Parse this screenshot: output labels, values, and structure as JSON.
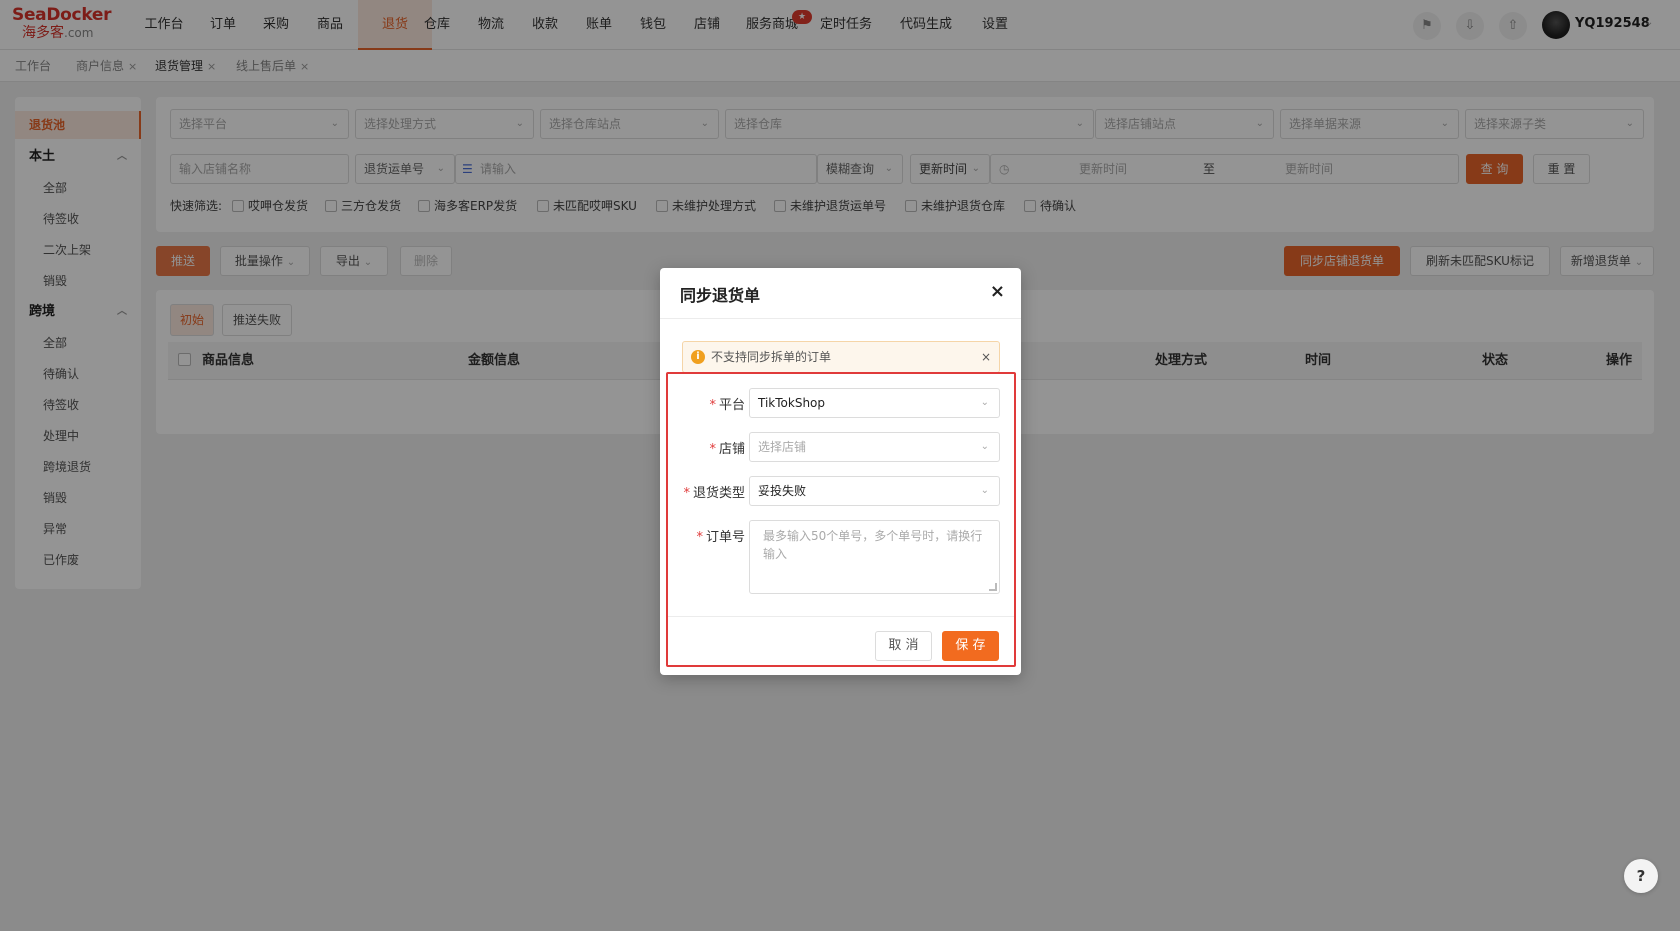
{
  "logo": {
    "line1": "SeaDocker",
    "line2": "海多客",
    "suffix": ".com"
  },
  "nav": {
    "items": [
      "工作台",
      "订单",
      "采购",
      "商品",
      "退货",
      "仓库",
      "物流",
      "收款",
      "账单",
      "钱包",
      "店铺",
      "服务商城",
      "定时任务",
      "代码生成",
      "设置"
    ],
    "active": "退货",
    "badge": "★"
  },
  "user": {
    "name": "YQ192548"
  },
  "tabs": [
    {
      "label": "工作台"
    },
    {
      "label": "商户信息",
      "close": "×"
    },
    {
      "label": "退货管理",
      "close": "×"
    },
    {
      "label": "线上售后单",
      "close": "×"
    }
  ],
  "sidebar": {
    "active": "退货池",
    "group1": "本土",
    "group1_items": [
      "全部",
      "待签收",
      "二次上架",
      "销毁"
    ],
    "group2": "跨境",
    "group2_items": [
      "全部",
      "待确认",
      "待签收",
      "处理中",
      "跨境退货",
      "销毁",
      "异常",
      "已作废"
    ]
  },
  "filters": {
    "row1": [
      "选择平台",
      "选择处理方式",
      "选择仓库站点",
      "选择仓库",
      "选择店铺站点",
      "选择单据来源",
      "选择来源子类"
    ],
    "store_name_placeholder": "输入店铺名称",
    "tracking_select": "退货运单号",
    "input_placeholder": "请输入",
    "fuzzy": "模糊查询",
    "time_type": "更新时间",
    "time_start": "更新时间",
    "time_sep": "至",
    "time_end": "更新时间",
    "query_btn": "查 询",
    "reset_btn": "重 置",
    "quick_label": "快速筛选:",
    "quick": [
      "哎呷仓发货",
      "三方仓发货",
      "海多客ERP发货",
      "未匹配哎呷SKU",
      "未维护处理方式",
      "未维护退货运单号",
      "未维护退货仓库",
      "待确认"
    ]
  },
  "actions": {
    "push": "推送",
    "batch": "批量操作",
    "export": "导出",
    "delete": "删除",
    "sync": "同步店铺退货单",
    "refresh": "刷新未匹配SKU标记",
    "new": "新增退货单"
  },
  "table": {
    "subtabs": [
      "初始",
      "推送失败"
    ],
    "headers": [
      "商品信息",
      "金额信息",
      "处理方式",
      "时间",
      "状态",
      "操作"
    ]
  },
  "dialog": {
    "title": "同步退货单",
    "close": "×",
    "alert": "不支持同步拆单的订单",
    "alert_icon": "i",
    "alert_close": "×",
    "fields": {
      "platform": {
        "label": "平台",
        "value": "TikTokShop"
      },
      "store": {
        "label": "店铺",
        "placeholder": "选择店铺"
      },
      "return_type": {
        "label": "退货类型",
        "value": "妥投失败"
      },
      "order_no": {
        "label": "订单号",
        "placeholder": "最多输入50个单号，多个单号时，请换行输入"
      }
    },
    "cancel": "取 消",
    "save": "保 存"
  },
  "help": "?"
}
